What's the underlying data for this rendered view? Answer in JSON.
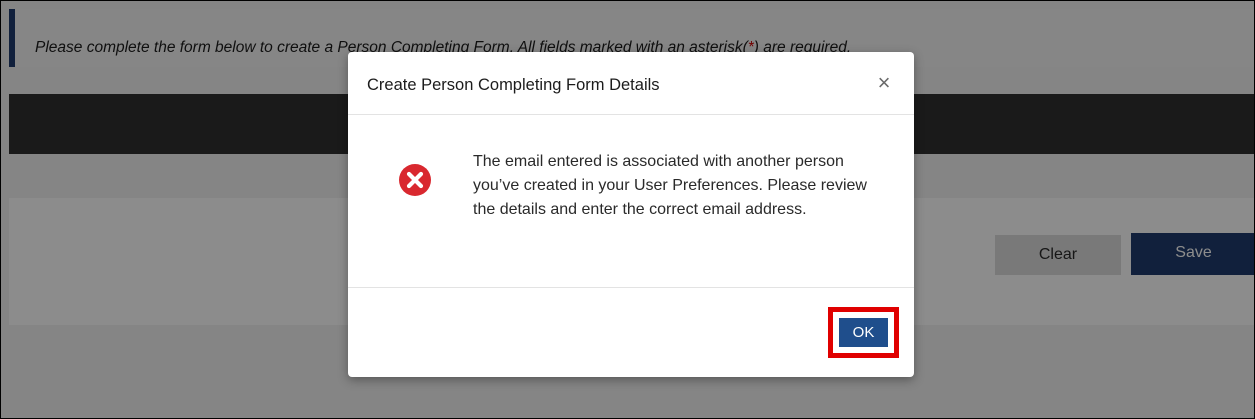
{
  "page": {
    "notice_text": "Please complete the form below to create a Person Completing Form. All fields marked with an asterisk(",
    "notice_asterisk": "*",
    "notice_text_end": ") are required.",
    "clear_label": "Clear",
    "save_label": "Save"
  },
  "modal": {
    "title": "Create Person Completing Form Details",
    "close_symbol": "×",
    "icon": "error-x-circle-icon",
    "message": "The email entered is associated with another person you’ve created in your User Preferences. Please review the details and enter the correct email address.",
    "ok_label": "OK"
  },
  "colors": {
    "navy": "#1f3b6d",
    "ok_blue": "#1f4e8c",
    "error_red": "#d9282f",
    "highlight_red": "#e00000"
  }
}
